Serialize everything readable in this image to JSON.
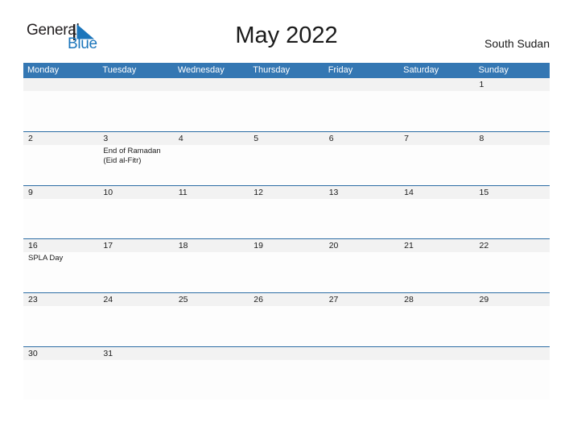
{
  "brand": {
    "word_one": "General",
    "word_two": "Blue"
  },
  "header": {
    "title": "May 2022",
    "region": "South Sudan"
  },
  "colors": {
    "header_blue": "#3477b3",
    "divider_blue": "#2b6ca3",
    "brand_blue": "#1b75bb",
    "daynum_band": "#f2f2f2"
  },
  "calendar": {
    "weekdays": [
      "Monday",
      "Tuesday",
      "Wednesday",
      "Thursday",
      "Friday",
      "Saturday",
      "Sunday"
    ],
    "weeks": [
      {
        "days": [
          {
            "num": "",
            "events": []
          },
          {
            "num": "",
            "events": []
          },
          {
            "num": "",
            "events": []
          },
          {
            "num": "",
            "events": []
          },
          {
            "num": "",
            "events": []
          },
          {
            "num": "",
            "events": []
          },
          {
            "num": "1",
            "events": []
          }
        ]
      },
      {
        "days": [
          {
            "num": "2",
            "events": []
          },
          {
            "num": "3",
            "events": [
              "End of Ramadan",
              "(Eid al-Fitr)"
            ]
          },
          {
            "num": "4",
            "events": []
          },
          {
            "num": "5",
            "events": []
          },
          {
            "num": "6",
            "events": []
          },
          {
            "num": "7",
            "events": []
          },
          {
            "num": "8",
            "events": []
          }
        ]
      },
      {
        "days": [
          {
            "num": "9",
            "events": []
          },
          {
            "num": "10",
            "events": []
          },
          {
            "num": "11",
            "events": []
          },
          {
            "num": "12",
            "events": []
          },
          {
            "num": "13",
            "events": []
          },
          {
            "num": "14",
            "events": []
          },
          {
            "num": "15",
            "events": []
          }
        ]
      },
      {
        "days": [
          {
            "num": "16",
            "events": [
              "SPLA Day"
            ]
          },
          {
            "num": "17",
            "events": []
          },
          {
            "num": "18",
            "events": []
          },
          {
            "num": "19",
            "events": []
          },
          {
            "num": "20",
            "events": []
          },
          {
            "num": "21",
            "events": []
          },
          {
            "num": "22",
            "events": []
          }
        ]
      },
      {
        "days": [
          {
            "num": "23",
            "events": []
          },
          {
            "num": "24",
            "events": []
          },
          {
            "num": "25",
            "events": []
          },
          {
            "num": "26",
            "events": []
          },
          {
            "num": "27",
            "events": []
          },
          {
            "num": "28",
            "events": []
          },
          {
            "num": "29",
            "events": []
          }
        ]
      },
      {
        "days": [
          {
            "num": "30",
            "events": []
          },
          {
            "num": "31",
            "events": []
          },
          {
            "num": "",
            "events": []
          },
          {
            "num": "",
            "events": []
          },
          {
            "num": "",
            "events": []
          },
          {
            "num": "",
            "events": []
          },
          {
            "num": "",
            "events": []
          }
        ]
      }
    ]
  }
}
